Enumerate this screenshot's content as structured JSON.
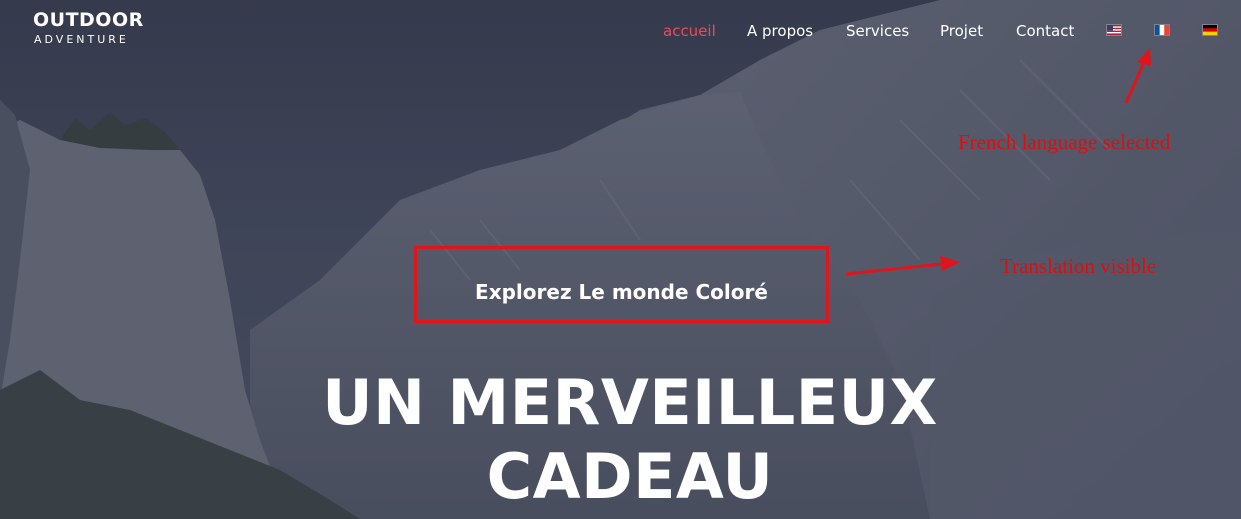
{
  "logo": {
    "line1": "OUTDOOR",
    "line2": "ADVENTURE"
  },
  "nav": {
    "items": [
      {
        "label": "accueil",
        "active": true
      },
      {
        "label": "A propos",
        "active": false
      },
      {
        "label": "Services",
        "active": false
      },
      {
        "label": "Projet",
        "active": false
      },
      {
        "label": "Contact",
        "active": false
      }
    ],
    "languages": [
      "us-flag-icon",
      "france-flag-icon",
      "germany-flag-icon"
    ],
    "selected_language": "france-flag-icon"
  },
  "hero": {
    "subtitle": "Explorez Le monde Coloré",
    "headline_line1": "UN MERVEILLEUX",
    "headline_line2": "CADEAU"
  },
  "annotations": {
    "french_selected": "French language selected",
    "translation_visible": "Translation visible"
  },
  "colors": {
    "active_nav": "#ee4a5c",
    "annotation": "#dd0e0e",
    "overlay": "#3b3f52"
  }
}
